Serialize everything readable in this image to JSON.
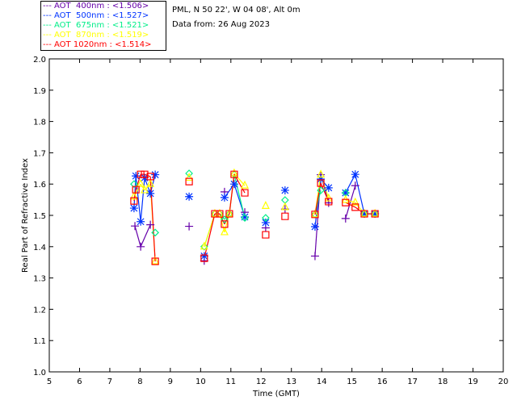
{
  "header": {
    "site": "PML, N 50 22', W 04 08', Alt 0m",
    "date": "Data from: 26 Aug 2023"
  },
  "chart_data": {
    "type": "scatter",
    "xlabel": "Time (GMT)",
    "ylabel": "Real Part of Refractive Index",
    "xlim": [
      5,
      20
    ],
    "ylim": [
      1.0,
      2.0
    ],
    "xticks": [
      5,
      6,
      7,
      8,
      9,
      10,
      11,
      12,
      13,
      14,
      15,
      16,
      17,
      18,
      19,
      20
    ],
    "yticks": [
      "1.0",
      "1.1",
      "1.2",
      "1.3",
      "1.4",
      "1.5",
      "1.6",
      "1.7",
      "1.8",
      "1.9",
      "2.0"
    ],
    "grid": false,
    "legend_placement": "top-left outside",
    "series": [
      {
        "name": "AOT  400nm : <1.506>",
        "color": "#6600aa",
        "marker": "plus",
        "x": [
          7.83,
          8.02,
          8.34,
          9.62,
          10.12,
          10.79,
          11.46,
          12.15,
          12.79,
          13.78,
          13.97,
          14.23,
          14.79,
          15.11
        ],
        "y": [
          1.466,
          1.4,
          1.47,
          1.465,
          1.355,
          1.575,
          1.51,
          1.46,
          1.52,
          1.37,
          1.63,
          1.54,
          1.49,
          1.595
        ]
      },
      {
        "name": "AOT  500nm : <1.527>",
        "color": "#0033ff",
        "marker": "asterisk",
        "x": [
          7.8,
          7.86,
          8.02,
          8.15,
          8.34,
          8.5,
          9.62,
          10.12,
          10.79,
          11.11,
          11.46,
          12.15,
          12.79,
          13.78,
          13.97,
          14.23,
          14.79,
          15.11,
          15.41,
          15.76
        ],
        "y": [
          1.523,
          1.626,
          1.48,
          1.62,
          1.57,
          1.63,
          1.56,
          1.37,
          1.557,
          1.6,
          1.495,
          1.477,
          1.58,
          1.464,
          1.616,
          1.588,
          1.572,
          1.631,
          1.505,
          1.505
        ]
      },
      {
        "name": "AOT  675nm : <1.521>",
        "color": "#00ee88",
        "marker": "diamond",
        "x": [
          7.8,
          8.5,
          9.62,
          10.12,
          10.47,
          10.63,
          10.79,
          10.95,
          11.11,
          11.46,
          12.15,
          12.79,
          13.78,
          13.97,
          14.79,
          15.41,
          15.76
        ],
        "y": [
          1.6,
          1.445,
          1.634,
          1.4,
          1.505,
          1.505,
          1.487,
          1.505,
          1.631,
          1.492,
          1.492,
          1.549,
          1.503,
          1.58,
          1.572,
          1.505,
          1.505
        ]
      },
      {
        "name": "AOT  870nm : <1.519>",
        "color": "#ffff00",
        "marker": "triangle",
        "x": [
          7.8,
          8.02,
          8.15,
          8.34,
          8.5,
          9.62,
          10.12,
          10.47,
          10.63,
          10.79,
          10.95,
          11.11,
          11.46,
          12.15,
          12.79,
          13.78,
          13.97,
          14.23,
          14.79,
          15.11,
          15.41,
          15.76
        ],
        "y": [
          1.56,
          1.6,
          1.58,
          1.6,
          1.353,
          1.62,
          1.4,
          1.505,
          1.505,
          1.446,
          1.505,
          1.634,
          1.595,
          1.53,
          1.526,
          1.503,
          1.63,
          1.554,
          1.549,
          1.541,
          1.505,
          1.505
        ]
      },
      {
        "name": "AOT 1020nm : <1.514>",
        "color": "#ff0000",
        "marker": "square",
        "x": [
          7.8,
          7.86,
          8.02,
          8.15,
          8.34,
          8.5,
          9.62,
          10.12,
          10.47,
          10.63,
          10.79,
          10.95,
          11.11,
          11.46,
          12.15,
          12.79,
          13.78,
          13.97,
          14.23,
          14.79,
          15.11,
          15.41,
          15.76
        ],
        "y": [
          1.546,
          1.582,
          1.631,
          1.631,
          1.624,
          1.353,
          1.608,
          1.363,
          1.505,
          1.505,
          1.472,
          1.505,
          1.631,
          1.572,
          1.438,
          1.497,
          1.503,
          1.603,
          1.544,
          1.541,
          1.526,
          1.505,
          1.505
        ]
      }
    ]
  }
}
